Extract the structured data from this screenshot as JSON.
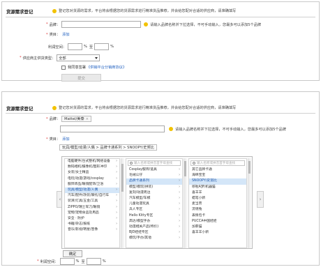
{
  "panel1": {
    "title": "货源需求登记",
    "notice": "登记您对货源的需求，平台将会根据您的货源需求进行精准货品推荐，并会给您配对合适的供应商，请准确填写",
    "brand_label": "品牌：",
    "brand_hint": "请输入品牌名称并下拉选择，不可手动输入，您最多可以添加5个品牌",
    "category_label": "类目：",
    "category_link": "添加",
    "margin_label": "利润空间：",
    "pct": "%",
    "to": "至",
    "supplier_type_label": "供应商主供货类型：",
    "supplier_type_value": "全部",
    "agree_text": "我同意签署",
    "agreement_link": "《供销平台分销商协议》",
    "submit_label": "提交"
  },
  "panel2": {
    "title": "货源需求登记",
    "notice": "登记您对货源的需求，平台将会根据您的货源需求进行精准货品推荐，并会给您配对合适的供应商，请准确填写",
    "brand_label": "品牌：",
    "brand_tag": "Mattel/美泰",
    "brand_tag_close": "×",
    "brand_hint": "请输入品牌名称并下拉选择，不可手动输入，您最多可以添加5个品牌",
    "category_label": "类目：",
    "category_link": "添加",
    "category_crumb": "玩具/模型/动漫/人偶 > 品牌卡通系列 > SNOOPY/史努比",
    "search_placeholder": "输入名称或拼音首字母查找",
    "col1": [
      "电脑硬件/台式整机/网络设备",
      "数码相机/摄像机/图形冲印",
      "女装/女士精品",
      "电玩/动漫/游戏/cosplay",
      "服饰饰品/眼镜配饰/卫浴",
      "玩具/模型/动漫/人偶",
      "汽车/配件/改装/摩托/自行车",
      "装潢/灯具/五金/工具",
      "ZIPPO/瑞士军刀/眼镜",
      "宠物/宠物食品及用品",
      "安全 · 防护",
      "书籍/杂志/报纸",
      "音乐/影视/明星/音像"
    ],
    "col2": [
      "Cosplay服饰/道具",
      "毛绒公仔",
      "品牌卡通系列",
      "模型/模玩(拼装)",
      "复刻/动漫周边",
      "汽车模型/车模",
      "儿童动漫玩具",
      "兵人专区",
      "Hello Kitty专区",
      "高达/模型手办",
      "动漫相关产品(特价)",
      "BJD娃娃专区",
      "模玩/手办/其他"
    ],
    "col3": [
      "其它品牌卡通",
      "海绵宝宝",
      "SNOOPY/史努比",
      "哆啦A梦/机器猫",
      "喜羊羊",
      "蜡笔小新",
      "麦当劳",
      "流氓兔",
      "表情包卡",
      "PUCCA中国娃娃",
      "加菲猫",
      "喜羊羊小新"
    ],
    "selected_col1": "玩具/模型/动漫/人偶",
    "selected_col2": "品牌卡通系列",
    "selected_col3": "SNOOPY/史努比",
    "confirm_label": "确定",
    "margin_label": "利润空间：",
    "pct": "%",
    "to": "至"
  },
  "colors": {
    "required": "#dd3333",
    "link": "#2060c0",
    "selected_bg": "#d4e6f8",
    "bulb": "#f2c200"
  },
  "icons": {
    "notice": "lightbulb-icon",
    "search": "search-icon",
    "left": "chevron-left-icon",
    "right": "chevron-right-icon"
  }
}
